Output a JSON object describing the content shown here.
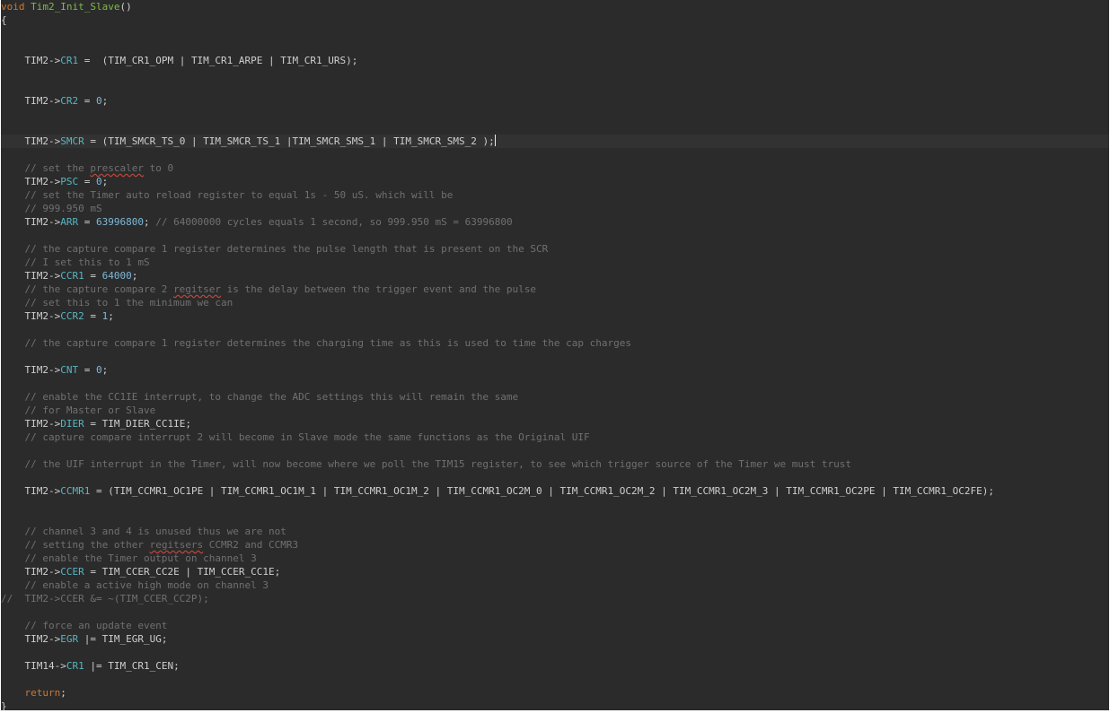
{
  "code": {
    "l01_kw": "void",
    "l01_fn": "Tim2_Init_Slave",
    "l01_paren": "()",
    "l02": "{",
    "l06_a": "    TIM2->",
    "l06_b": "CR1",
    "l06_c": " =  (TIM_CR1_OPM | TIM_CR1_ARPE | TIM_CR1_URS);",
    "l09_a": "    TIM2->",
    "l09_b": "CR2",
    "l09_c": " = ",
    "l09_d": "0",
    "l09_e": ";",
    "l12_a": "    TIM2->",
    "l12_b": "SMCR",
    "l12_c": " = (TIM_SMCR_TS_0 | TIM_SMCR_TS_1 |TIM_SMCR_SMS_1 | TIM_SMCR_SMS_2 );",
    "l14_a": "    // set the ",
    "l14_b": "prescaler",
    "l14_c": " to 0",
    "l15_a": "    TIM2->",
    "l15_b": "PSC",
    "l15_c": " = ",
    "l15_d": "0",
    "l15_e": ";",
    "l16": "    // set the Timer auto reload register to equal 1s - 50 uS. which will be",
    "l17": "    // 999.950 mS",
    "l18_a": "    TIM2->",
    "l18_b": "ARR",
    "l18_c": " = ",
    "l18_d": "63996800",
    "l18_e": "; ",
    "l18_f": "// 64000000 cycles equals 1 second, so 999.950 mS = 63996800",
    "l20": "    // the capture compare 1 register determines the pulse length that is present on the SCR",
    "l21": "    // I set this to 1 mS",
    "l22_a": "    TIM2->",
    "l22_b": "CCR1",
    "l22_c": " = ",
    "l22_d": "64000",
    "l22_e": ";",
    "l23_a": "    // the capture compare 2 ",
    "l23_b": "regitser",
    "l23_c": " is the delay between the trigger event and the pulse",
    "l24": "    // set this to 1 the minimum we can",
    "l25_a": "    TIM2->",
    "l25_b": "CCR2",
    "l25_c": " = ",
    "l25_d": "1",
    "l25_e": ";",
    "l27": "    // the capture compare 1 register determines the charging time as this is used to time the cap charges",
    "l29_a": "    TIM2->",
    "l29_b": "CNT",
    "l29_c": " = ",
    "l29_d": "0",
    "l29_e": ";",
    "l31": "    // enable the CC1IE interrupt, to change the ADC settings this will remain the same",
    "l32": "    // for Master or Slave",
    "l33_a": "    TIM2->",
    "l33_b": "DIER",
    "l33_c": " = TIM_DIER_CC1IE;",
    "l34": "    // capture compare interrupt 2 will become in Slave mode the same functions as the Original UIF",
    "l36": "    // the UIF interrupt in the Timer, will now become where we poll the TIM15 register, to see which trigger source of the Timer we must trust",
    "l38_a": "    TIM2->",
    "l38_b": "CCMR1",
    "l38_c": " = (TIM_CCMR1_OC1PE | TIM_CCMR1_OC1M_1 | TIM_CCMR1_OC1M_2 | TIM_CCMR1_OC2M_0 | TIM_CCMR1_OC2M_2 | TIM_CCMR1_OC2M_3 | TIM_CCMR1_OC2PE | TIM_CCMR1_OC2FE);",
    "l41": "    // channel 3 and 4 is unused thus we are not",
    "l42_a": "    // setting the other ",
    "l42_b": "regitsers",
    "l42_c": " CCMR2 and CCMR3",
    "l43": "    // enable the Timer output on channel 3",
    "l44_a": "    TIM2->",
    "l44_b": "CCER",
    "l44_c": " = TIM_CCER_CC2E | TIM_CCER_CC1E;",
    "l45": "    // enable a active high mode on channel 3",
    "l46": "//  TIM2->CCER &= ~(TIM_CCER_CC2P);",
    "l48": "    // force an update event",
    "l49_a": "    TIM2->",
    "l49_b": "EGR",
    "l49_c": " |= TIM_EGR_UG;",
    "l51_a": "    TIM14->",
    "l51_b": "CR1",
    "l51_c": " |= TIM_CR1_CEN;",
    "l53_a": "    ",
    "l53_b": "return",
    "l53_c": ";",
    "l54": "}"
  },
  "colors": {
    "background": "#2b2b2b",
    "current_line": "#323232",
    "keyword": "#cc7832",
    "function_name": "#7fb94b",
    "member": "#56b6c2",
    "number": "#7fb8d9",
    "comment": "#707070",
    "text": "#cfcfcf",
    "spell_error": "#c4473a"
  }
}
